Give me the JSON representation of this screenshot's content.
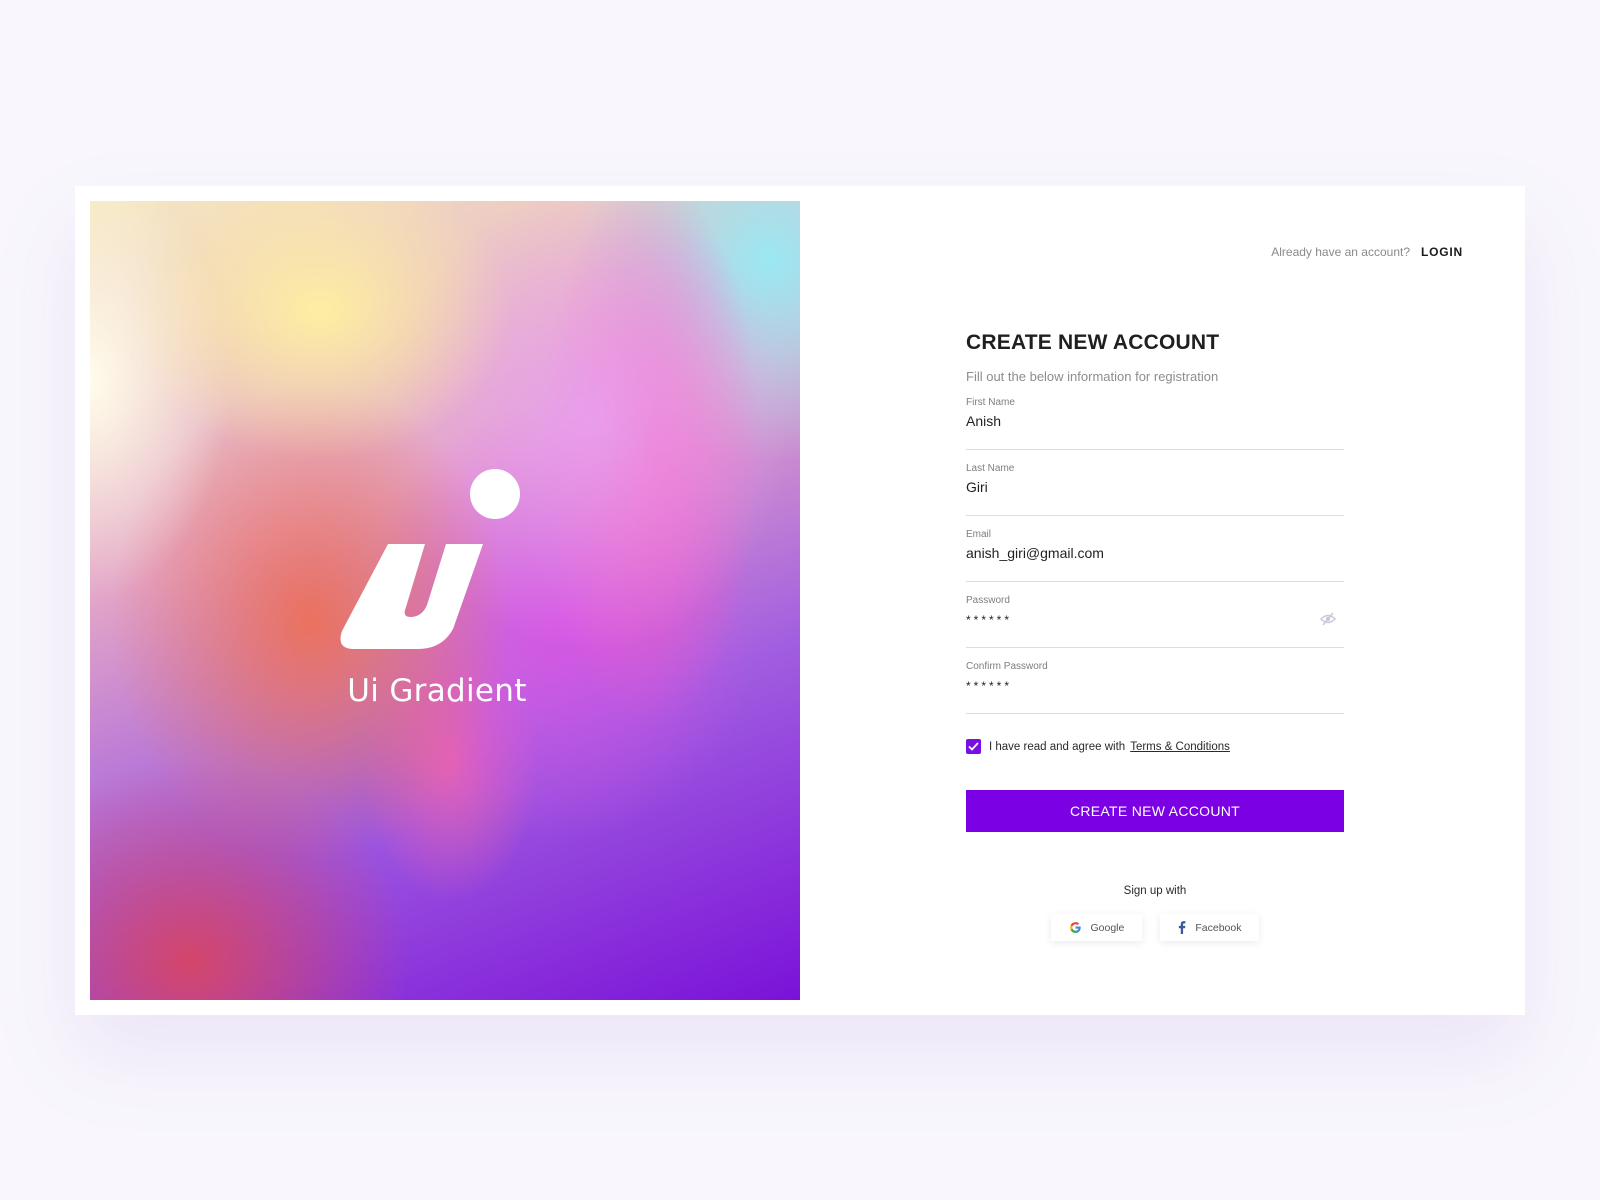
{
  "brand": {
    "name": "Ui Gradient",
    "logo_icon": "ui-gradient-logo-icon",
    "accent": "#7b00e3"
  },
  "header": {
    "prompt": "Already have an account?",
    "login_label": "LOGIN"
  },
  "form": {
    "title": "CREATE NEW ACCOUNT",
    "subtitle": "Fill out the below information for registration",
    "fields": [
      {
        "label": "First Name",
        "value": "Anish"
      },
      {
        "label": "Last Name",
        "value": "Giri"
      },
      {
        "label": "Email",
        "value": "anish_giri@gmail.com"
      },
      {
        "label": "Password",
        "value": "******"
      },
      {
        "label": "Confirm Password",
        "value": "******"
      }
    ],
    "password_toggle_icon": "eye-off-icon",
    "agree_text": "I have read and agree with",
    "terms_link": "Terms & Conditions",
    "agree_checked": true,
    "submit_label": "CREATE NEW ACCOUNT"
  },
  "social": {
    "heading": "Sign up with",
    "providers": [
      {
        "label": "Google",
        "icon": "google-icon"
      },
      {
        "label": "Facebook",
        "icon": "facebook-icon"
      }
    ]
  }
}
